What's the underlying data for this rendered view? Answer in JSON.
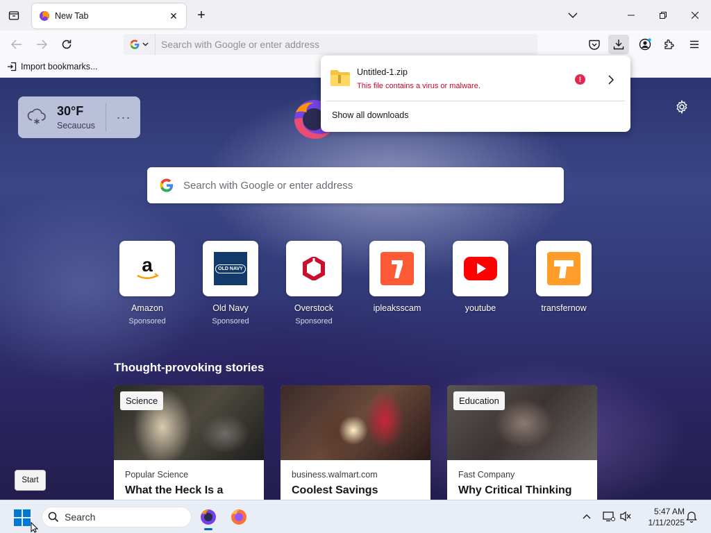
{
  "tabs": [
    {
      "title": "New Tab"
    }
  ],
  "urlbar": {
    "placeholder": "Search with Google or enter address"
  },
  "bookmarks": {
    "import_label": "Import bookmarks..."
  },
  "weather": {
    "temp": "30°F",
    "city": "Secaucus"
  },
  "search": {
    "placeholder": "Search with Google or enter address"
  },
  "shortcuts": [
    {
      "label": "Amazon",
      "sponsored": "Sponsored"
    },
    {
      "label": "Old Navy",
      "sponsored": "Sponsored",
      "logo_text": "OLD NAVY"
    },
    {
      "label": "Overstock",
      "sponsored": "Sponsored"
    },
    {
      "label": "ipleaksscam",
      "sponsored": ""
    },
    {
      "label": "youtube",
      "sponsored": ""
    },
    {
      "label": "transfernow",
      "sponsored": ""
    }
  ],
  "stories": {
    "title": "Thought-provoking stories",
    "cards": [
      {
        "tag": "Science",
        "source": "Popular Science",
        "headline": "What the Heck Is a"
      },
      {
        "tag": "",
        "source": "business.walmart.com",
        "headline": "Coolest Savings"
      },
      {
        "tag": "Education",
        "source": "Fast Company",
        "headline": "Why Critical Thinking"
      }
    ]
  },
  "downloads": {
    "filename": "Untitled-1.zip",
    "status": "This file contains a virus or malware.",
    "show_all": "Show all downloads"
  },
  "tooltip": {
    "start": "Start"
  },
  "taskbar": {
    "search_placeholder": "Search",
    "time": "5:47 AM",
    "date": "1/11/2025"
  },
  "colors": {
    "danger": "#d70022",
    "accent": "#0067c0"
  }
}
